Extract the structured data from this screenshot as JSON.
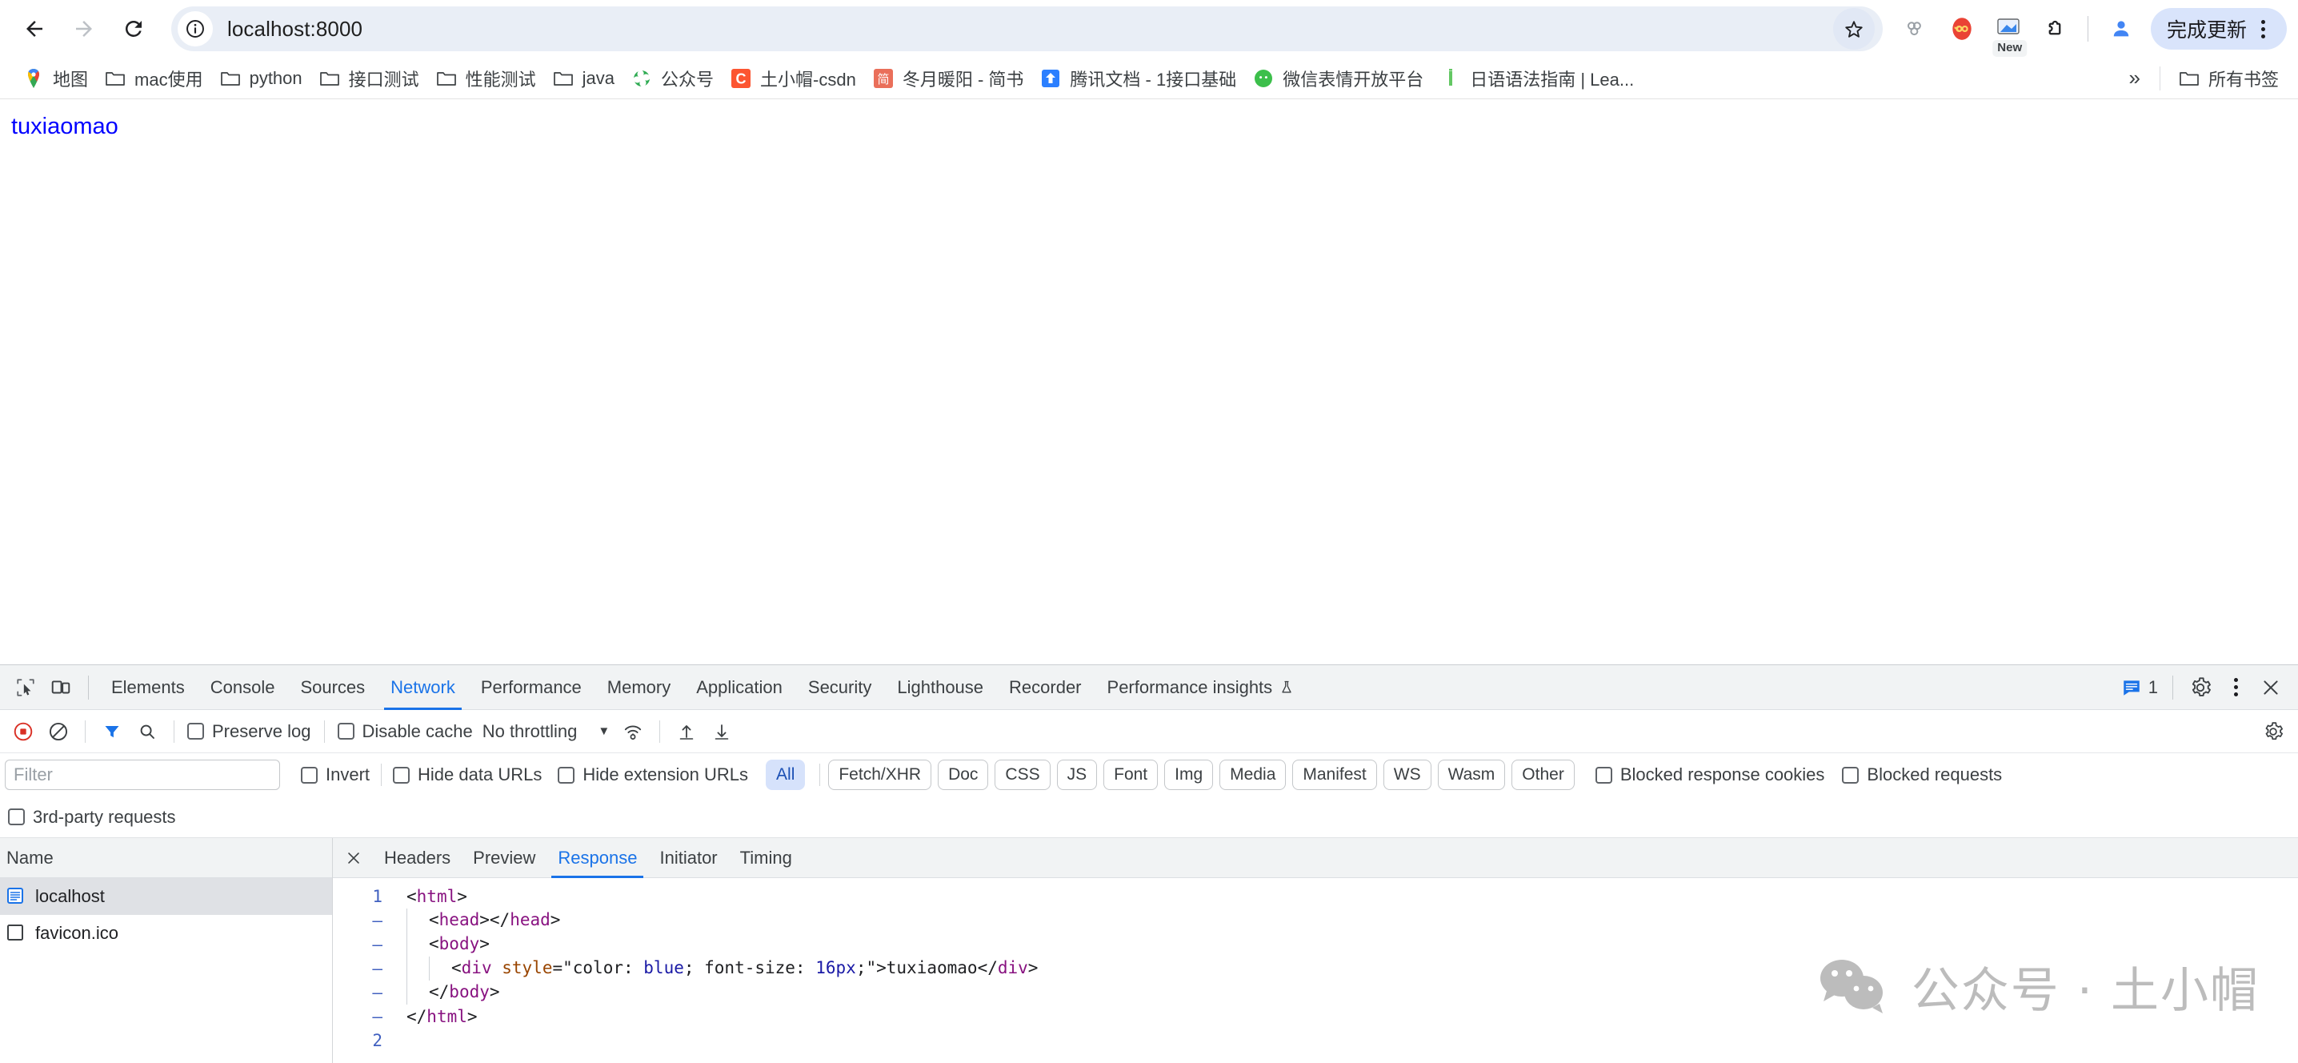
{
  "browser": {
    "back_label": "Back",
    "forward_label": "Forward",
    "reload_label": "Reload",
    "url": "localhost:8000",
    "site_info_icon": "info-circle-icon",
    "bookmark_star_icon": "star-icon",
    "update_button_label": "完成更新",
    "new_badge": "New",
    "icons": {
      "star": "star-icon",
      "extensions_group": "chain-links-icon",
      "infinity": "infinity-extension-icon",
      "screenshot": "image-extension-icon",
      "puzzle": "extensions-puzzle-icon",
      "profile": "profile-avatar-icon",
      "menu": "three-dot-menu-icon"
    }
  },
  "bookmarks": {
    "items": [
      {
        "label": "地图",
        "icon": "google-maps-pin-icon"
      },
      {
        "label": "mac使用",
        "icon": "folder-icon"
      },
      {
        "label": "python",
        "icon": "folder-icon"
      },
      {
        "label": "接口测试",
        "icon": "folder-icon"
      },
      {
        "label": "性能测试",
        "icon": "folder-icon"
      },
      {
        "label": "java",
        "icon": "folder-icon"
      },
      {
        "label": "公众号",
        "icon": "green-swirl-icon"
      },
      {
        "label": "土小帽-csdn",
        "icon": "csdn-c-icon"
      },
      {
        "label": "冬月暖阳 - 简书",
        "icon": "jianshu-icon"
      },
      {
        "label": "腾讯文档 - 1接口基础",
        "icon": "tencent-docs-icon"
      },
      {
        "label": "微信表情开放平台",
        "icon": "wechat-icon"
      },
      {
        "label": "日语语法指南 | Lea...",
        "icon": "green-bar-icon"
      }
    ],
    "overflow_label": "»",
    "all_bookmarks_label": "所有书签",
    "all_bookmarks_icon": "folder-icon"
  },
  "page": {
    "text": "tuxiaomao",
    "text_color": "#0000ff"
  },
  "devtools": {
    "inspect_icon": "inspect-element-icon",
    "device_icon": "device-toolbar-icon",
    "tabs": [
      {
        "label": "Elements",
        "active": false
      },
      {
        "label": "Console",
        "active": false
      },
      {
        "label": "Sources",
        "active": false
      },
      {
        "label": "Network",
        "active": true
      },
      {
        "label": "Performance",
        "active": false
      },
      {
        "label": "Memory",
        "active": false
      },
      {
        "label": "Application",
        "active": false
      },
      {
        "label": "Security",
        "active": false
      },
      {
        "label": "Lighthouse",
        "active": false
      },
      {
        "label": "Recorder",
        "active": false
      },
      {
        "label": "Performance insights",
        "active": false,
        "beaker": true
      }
    ],
    "message_count": "1",
    "message_icon": "message-bubble-icon",
    "settings_icon": "gear-icon",
    "more_icon": "three-dot-menu-icon",
    "close_icon": "close-icon",
    "accent_color": "#1a73e8"
  },
  "network_toolbar": {
    "record_icon": "record-stop-icon",
    "clear_icon": "clear-network-icon",
    "filter_icon": "filter-funnel-icon",
    "search_icon": "search-icon",
    "preserve_log_label": "Preserve log",
    "preserve_log_checked": false,
    "disable_cache_label": "Disable cache",
    "disable_cache_checked": false,
    "throttling_value": "No throttling",
    "wifi_icon": "network-conditions-icon",
    "import_icon": "import-har-icon",
    "export_icon": "export-har-icon",
    "settings_icon": "network-settings-gear-icon"
  },
  "filter_row": {
    "filter_placeholder": "Filter",
    "filter_value": "",
    "invert_label": "Invert",
    "invert_checked": false,
    "hide_data_urls_label": "Hide data URLs",
    "hide_data_urls_checked": false,
    "hide_extension_urls_label": "Hide extension URLs",
    "hide_extension_urls_checked": false,
    "type_chips": [
      {
        "label": "All",
        "active": true
      },
      {
        "label": "Fetch/XHR",
        "active": false
      },
      {
        "label": "Doc",
        "active": false
      },
      {
        "label": "CSS",
        "active": false
      },
      {
        "label": "JS",
        "active": false
      },
      {
        "label": "Font",
        "active": false
      },
      {
        "label": "Img",
        "active": false
      },
      {
        "label": "Media",
        "active": false
      },
      {
        "label": "Manifest",
        "active": false
      },
      {
        "label": "WS",
        "active": false
      },
      {
        "label": "Wasm",
        "active": false
      },
      {
        "label": "Other",
        "active": false
      }
    ],
    "blocked_response_cookies_label": "Blocked response cookies",
    "blocked_response_cookies_checked": false,
    "blocked_requests_label": "Blocked requests",
    "blocked_requests_checked": false,
    "third_party_label": "3rd-party requests",
    "third_party_checked": false
  },
  "request_list": {
    "column_header": "Name",
    "rows": [
      {
        "name": "localhost",
        "icon": "document-blue-icon",
        "selected": true
      },
      {
        "name": "favicon.ico",
        "icon": "generic-file-icon",
        "selected": false
      }
    ]
  },
  "detail_tabs": {
    "close_label": "X",
    "tabs": [
      {
        "label": "Headers",
        "active": false
      },
      {
        "label": "Preview",
        "active": false
      },
      {
        "label": "Response",
        "active": true
      },
      {
        "label": "Initiator",
        "active": false
      },
      {
        "label": "Timing",
        "active": false
      }
    ]
  },
  "response_code": {
    "lines": [
      {
        "num": "1",
        "indent": 0,
        "parts": [
          {
            "t": "<",
            "c": "punct"
          },
          {
            "t": "html",
            "c": "tg"
          },
          {
            "t": ">",
            "c": "punct"
          }
        ]
      },
      {
        "num": "–",
        "indent": 1,
        "parts": [
          {
            "t": "<",
            "c": "punct"
          },
          {
            "t": "head",
            "c": "tg"
          },
          {
            "t": ">",
            "c": "punct"
          },
          {
            "t": "</",
            "c": "punct"
          },
          {
            "t": "head",
            "c": "tg"
          },
          {
            "t": ">",
            "c": "punct"
          }
        ]
      },
      {
        "num": "–",
        "indent": 1,
        "parts": [
          {
            "t": "<",
            "c": "punct"
          },
          {
            "t": "body",
            "c": "tg"
          },
          {
            "t": ">",
            "c": "punct"
          }
        ]
      },
      {
        "num": "–",
        "indent": 2,
        "parts": [
          {
            "t": "<",
            "c": "punct"
          },
          {
            "t": "div",
            "c": "tg"
          },
          {
            "t": " ",
            "c": "pl"
          },
          {
            "t": "style",
            "c": "at"
          },
          {
            "t": "=",
            "c": "pl"
          },
          {
            "t": "\"color: ",
            "c": "pl"
          },
          {
            "t": "blue",
            "c": "st"
          },
          {
            "t": "; font-size: ",
            "c": "pl"
          },
          {
            "t": "16px",
            "c": "st"
          },
          {
            "t": ";\"",
            "c": "pl"
          },
          {
            "t": ">",
            "c": "punct"
          },
          {
            "t": "tuxiaomao",
            "c": "pl"
          },
          {
            "t": "</",
            "c": "punct"
          },
          {
            "t": "div",
            "c": "tg"
          },
          {
            "t": ">",
            "c": "punct"
          }
        ]
      },
      {
        "num": "–",
        "indent": 1,
        "parts": [
          {
            "t": "</",
            "c": "punct"
          },
          {
            "t": "body",
            "c": "tg"
          },
          {
            "t": ">",
            "c": "punct"
          }
        ]
      },
      {
        "num": "–",
        "indent": 0,
        "parts": [
          {
            "t": "</",
            "c": "punct"
          },
          {
            "t": "html",
            "c": "tg"
          },
          {
            "t": ">",
            "c": "punct"
          }
        ]
      },
      {
        "num": "2",
        "indent": 0,
        "parts": []
      }
    ]
  },
  "watermark": {
    "text": "公众号 · 土小帽",
    "icon": "wechat-logo-icon",
    "color": "#bcbcbc"
  }
}
